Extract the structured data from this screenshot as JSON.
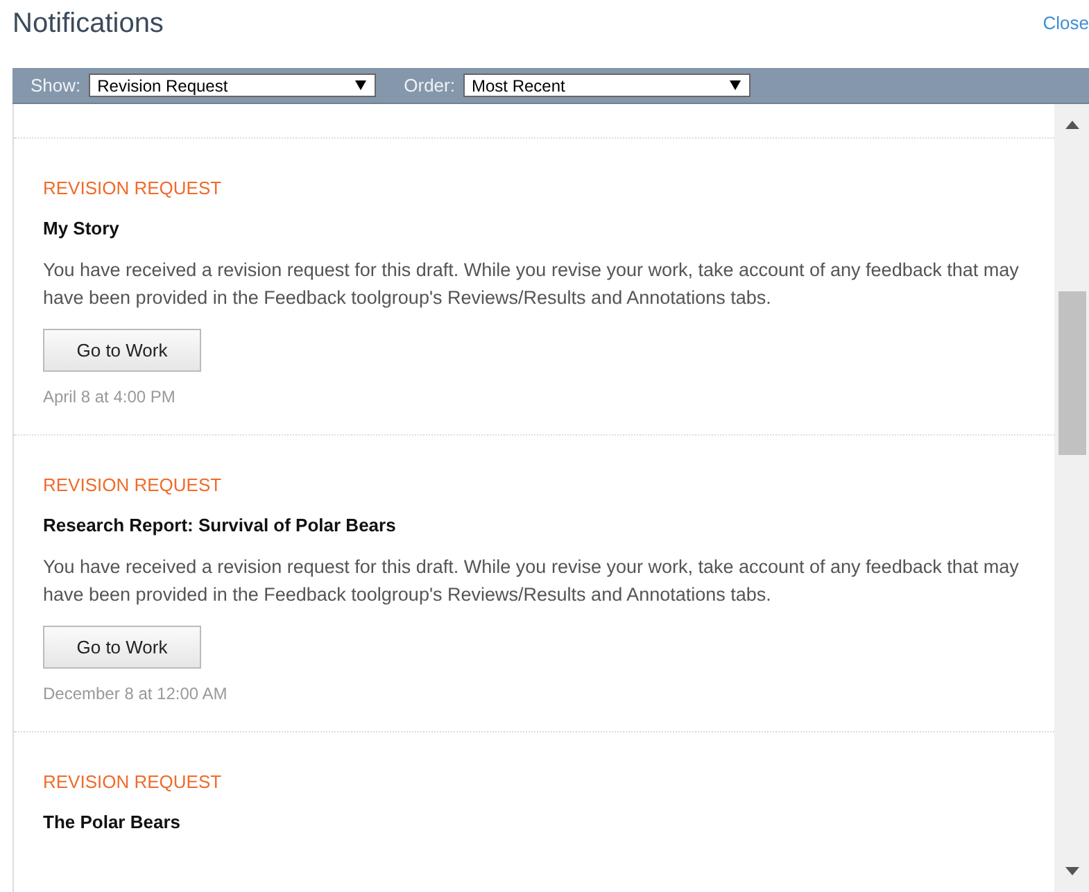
{
  "header": {
    "title": "Notifications",
    "close": "Close"
  },
  "filters": [
    {
      "label": "Show:",
      "value": "Revision Request"
    },
    {
      "label": "Order:",
      "value": "Most Recent"
    }
  ],
  "notifications": [
    {
      "category": "REVISION REQUEST",
      "title": "My Story",
      "message": "You have received a revision request for this draft. While you revise your work, take account of any feedback that may have been provided in the Feedback toolgroup's Reviews/Results and Annotations tabs.",
      "action": "Go to Work",
      "date": "April 8 at 4:00 PM"
    },
    {
      "category": "REVISION REQUEST",
      "title": "Research Report: Survival of Polar Bears",
      "message": "You have received a revision request for this draft. While you revise your work, take account of any feedback that may have been provided in the Feedback toolgroup's Reviews/Results and Annotations tabs.",
      "action": "Go to Work",
      "date": "December 8 at 12:00 AM"
    },
    {
      "category": "REVISION REQUEST",
      "title": "The Polar Bears"
    }
  ]
}
